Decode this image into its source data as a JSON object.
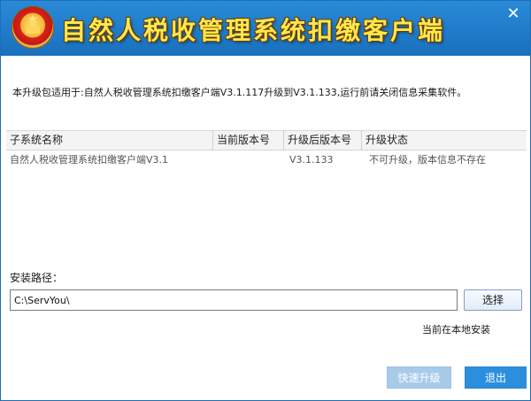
{
  "window": {
    "title": "自然人税收管理系统扣缴客户端",
    "close_symbol": "✕",
    "colors": {
      "titlebar": "#1f7cca",
      "title_text": "#ffe84d",
      "primary_button": "#2b8fde",
      "disabled_button": "#a9cbea"
    }
  },
  "notice": "本升级包适用于:自然人税收管理系统扣缴客户端V3.1.117升级到V3.1.133,运行前请关闭信息采集软件。",
  "table": {
    "headers": {
      "subsystem": "子系统名称",
      "current_version": "当前版本号",
      "target_version": "升级后版本号",
      "status": "升级状态"
    },
    "rows": [
      {
        "subsystem": "自然人税收管理系统扣缴客户端V3.1",
        "current_version": "",
        "target_version": "V3.1.133",
        "status": "不可升级，版本信息不存在"
      }
    ]
  },
  "install": {
    "label": "安装路径：",
    "path_value": "C:\\ServYou\\",
    "browse_label": "选择",
    "status": "当前在本地安装"
  },
  "buttons": {
    "quick_upgrade": "快速升级",
    "exit": "退出"
  },
  "icons": {
    "emblem": "national-tax-emblem-icon",
    "close": "close-icon"
  }
}
